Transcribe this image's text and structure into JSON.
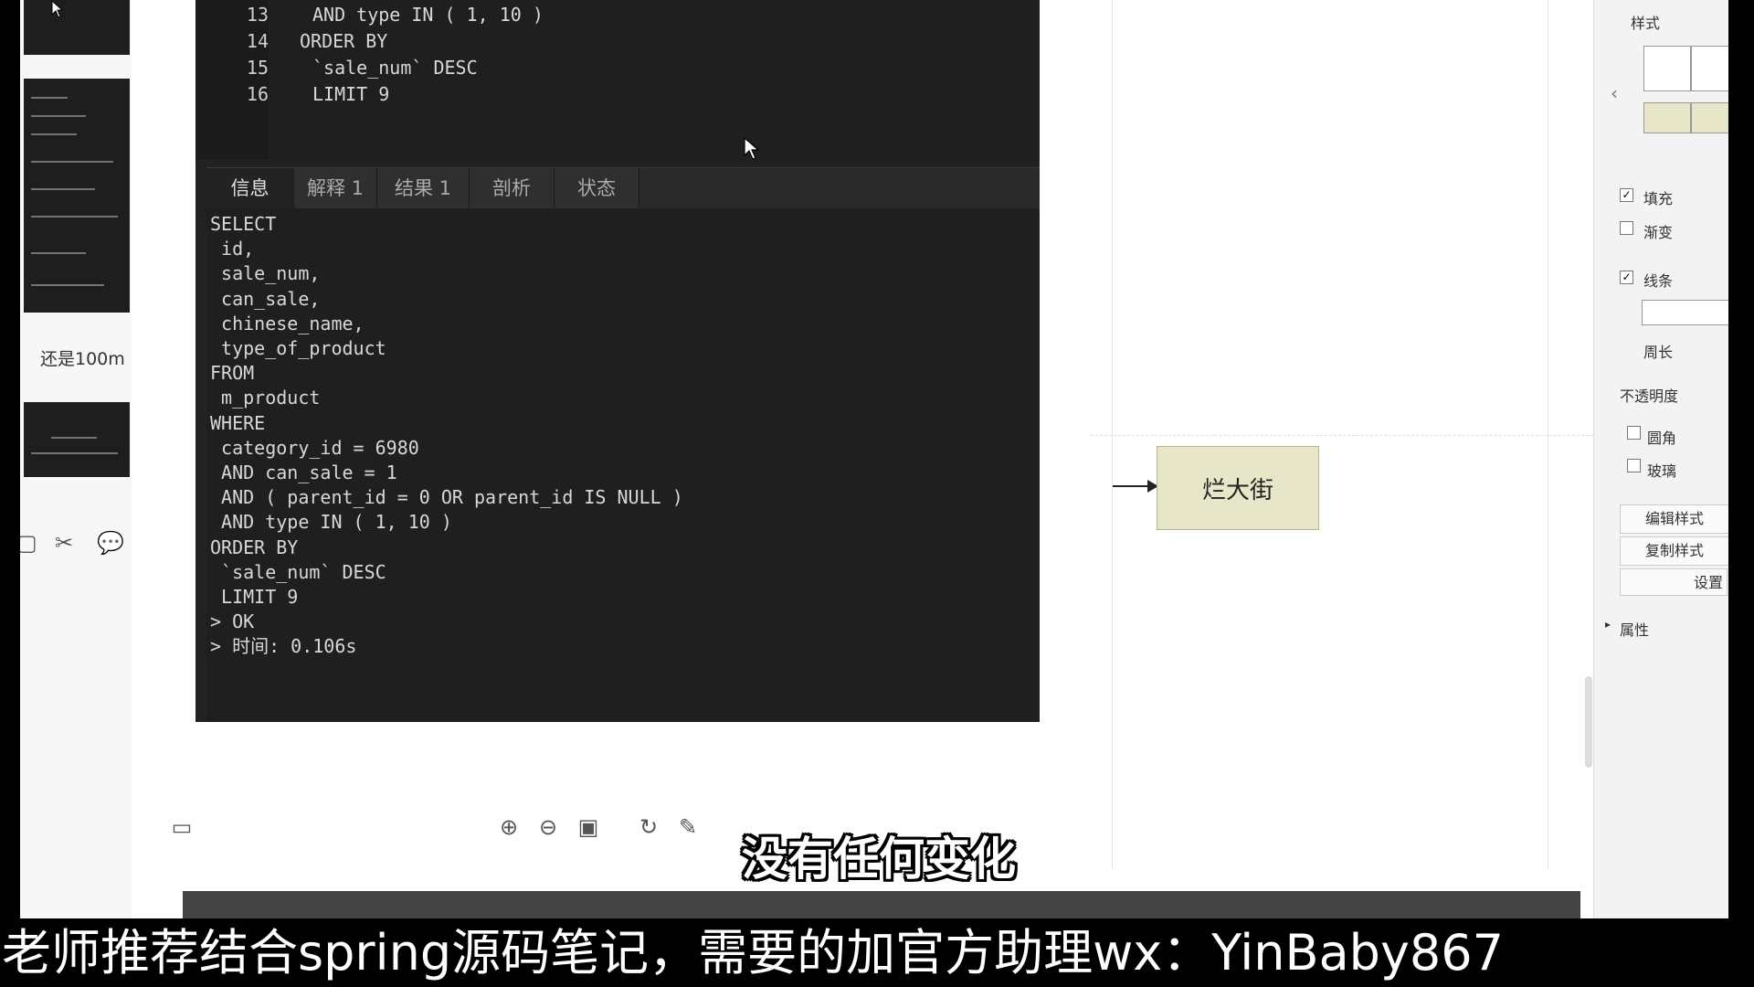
{
  "editor": {
    "top_lines": [
      {
        "num": "13",
        "code": "AND type IN ( 1, 10 )"
      },
      {
        "num": "14",
        "code": "ORDER BY"
      },
      {
        "num": "15",
        "code": "`sale_num` DESC"
      },
      {
        "num": "16",
        "code": "LIMIT 9"
      }
    ],
    "tabs": [
      "信息",
      "解释 1",
      "结果 1",
      "剖析",
      "状态"
    ],
    "output_lines": [
      "SELECT",
      " id,",
      " sale_num,",
      " can_sale,",
      " chinese_name,",
      " type_of_product",
      "FROM",
      " m_product",
      "WHERE",
      " category_id = 6980",
      " AND can_sale = 1",
      " AND ( parent_id = 0 OR parent_id IS NULL )",
      " AND type IN ( 1, 10 )",
      "ORDER BY",
      " `sale_num` DESC",
      " LIMIT 9",
      "> OK",
      "> 时间: 0.106s"
    ]
  },
  "thumbs": {
    "caption": "还是100m"
  },
  "node": {
    "label": "烂大街"
  },
  "right_panel": {
    "style_title": "样式",
    "fill": "填充",
    "gradient": "渐变",
    "line": "线条",
    "perimeter": "周长",
    "opacity": "不透明度",
    "rounded": "圆角",
    "glass": "玻璃",
    "edit_style": "编辑样式",
    "copy_style": "复制样式",
    "settings": "设置",
    "properties": "属性"
  },
  "subtitle": "没有任何变化",
  "banner": "老师推荐结合spring源码笔记，需要的加官方助理wx：YinBaby867",
  "colors": {
    "node_fill": "#e8e6c8",
    "editor_bg": "#222222"
  }
}
